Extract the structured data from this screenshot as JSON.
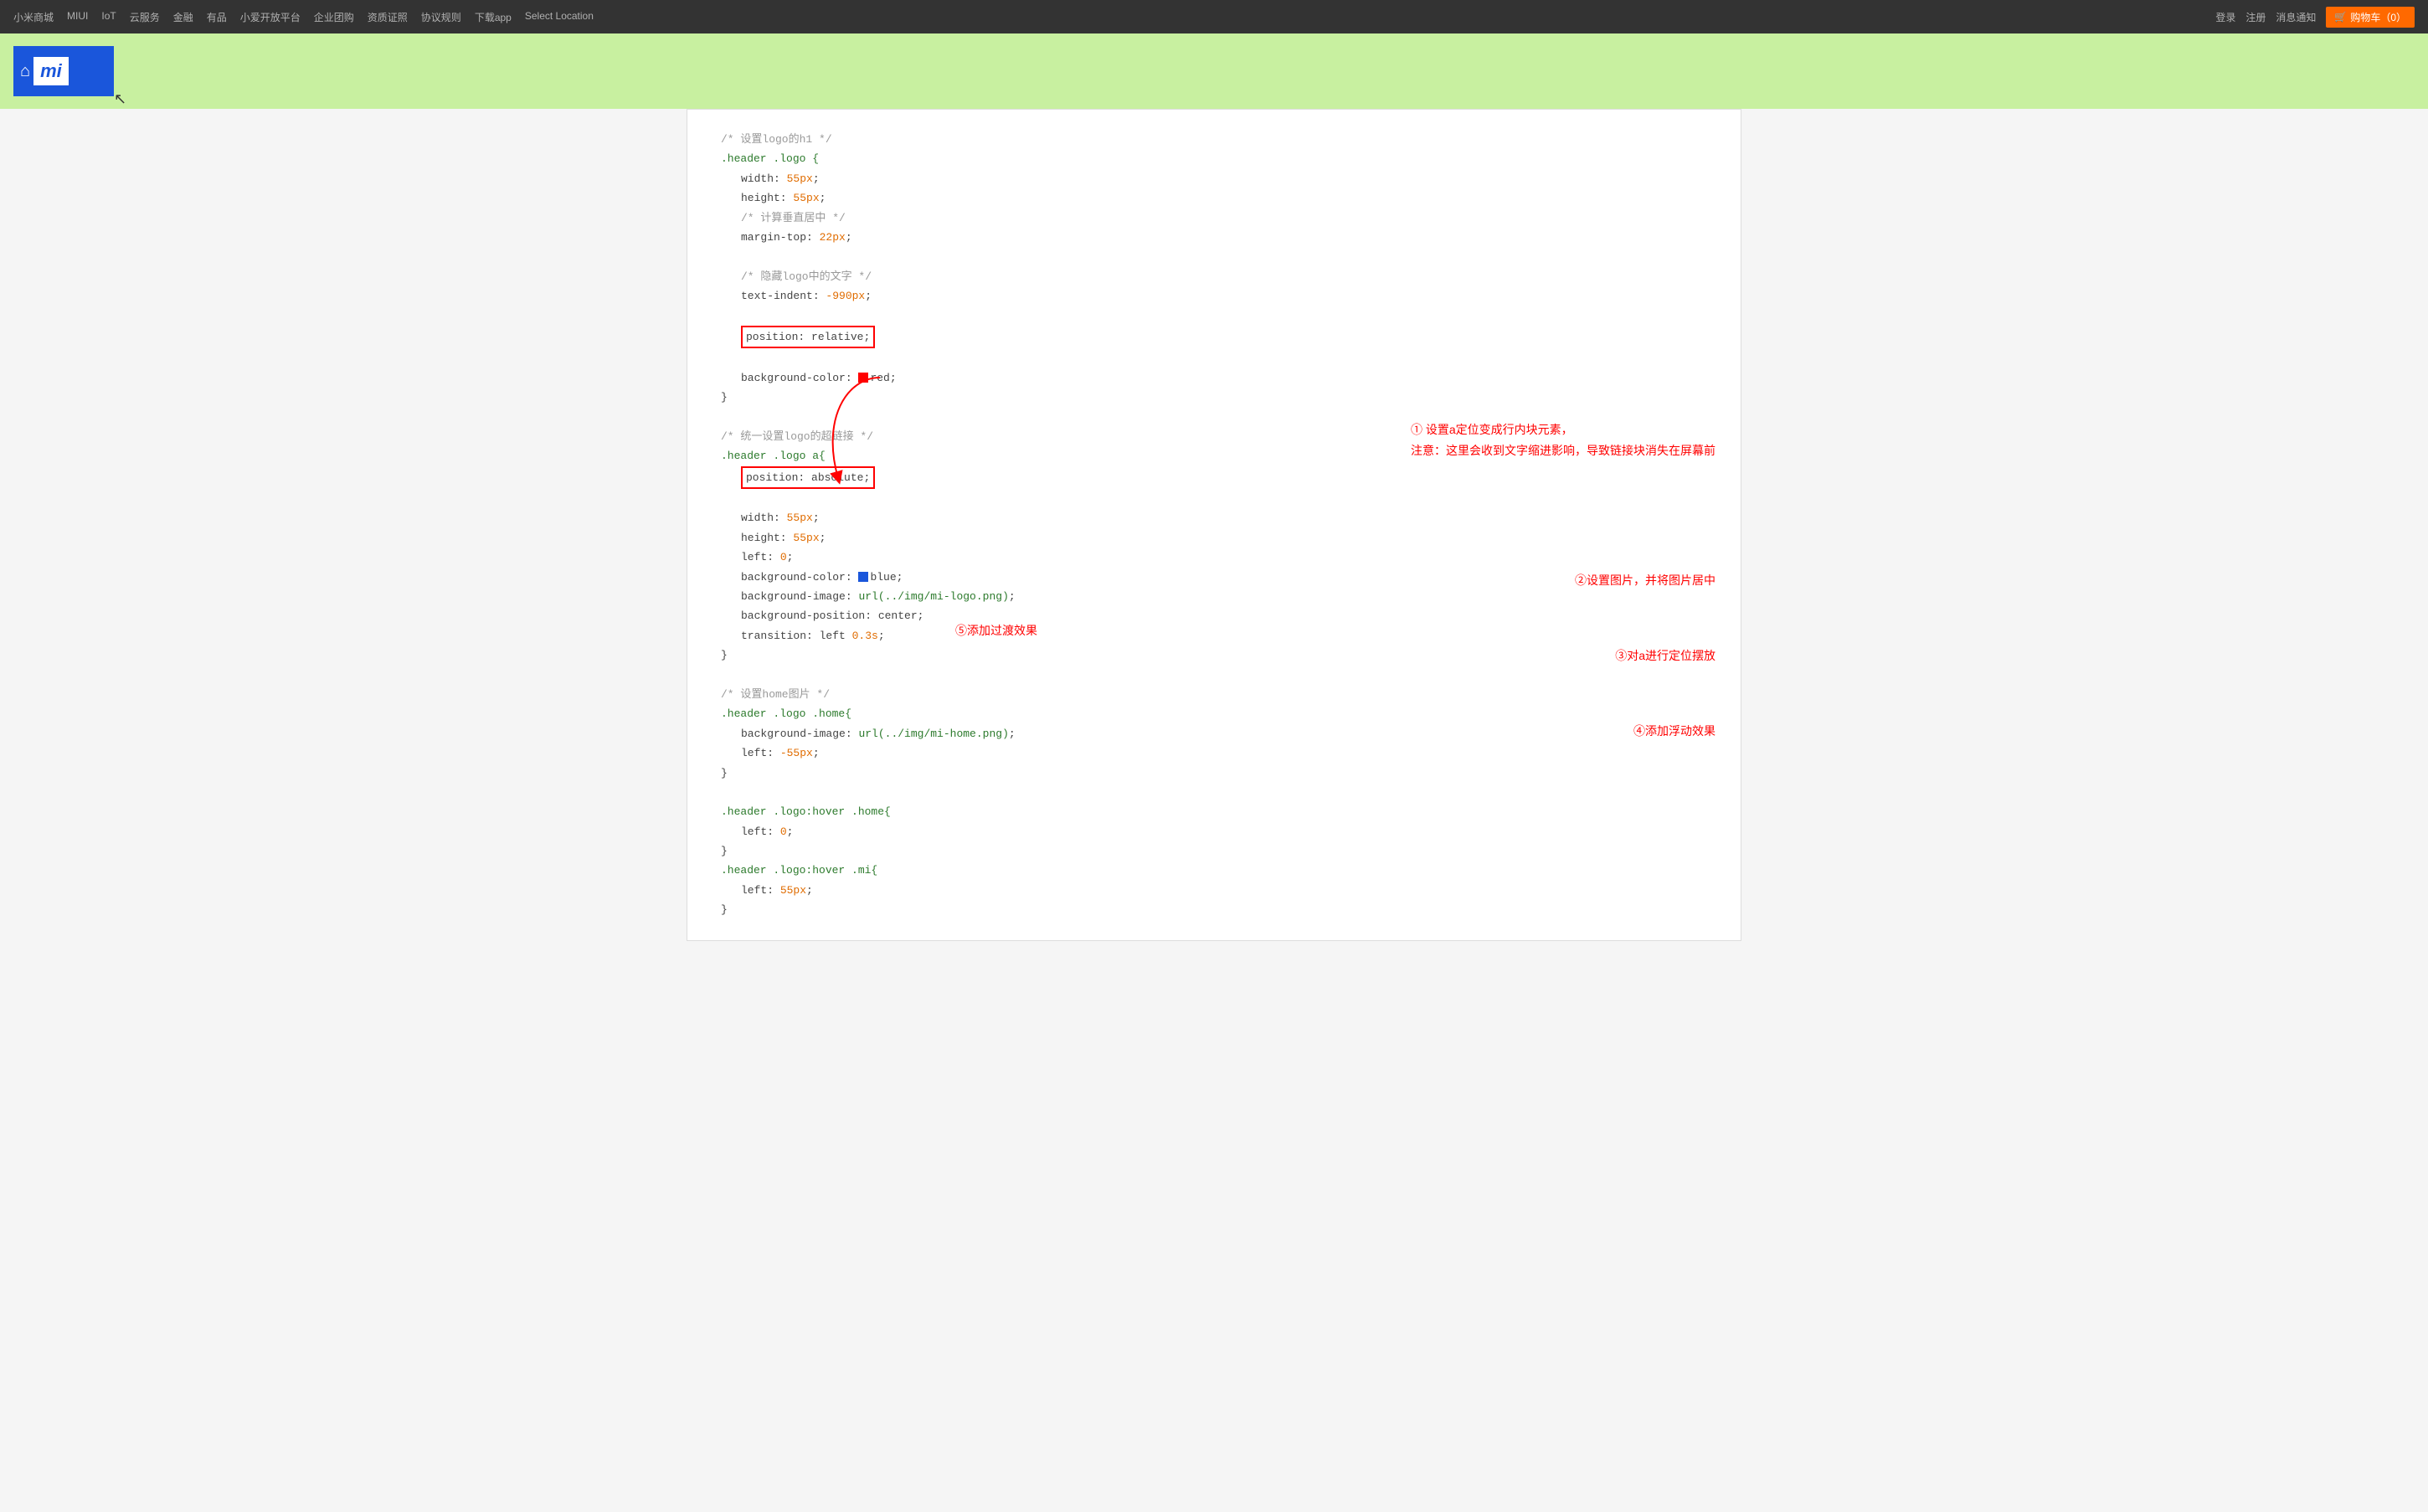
{
  "nav": {
    "left_links": [
      "小米商城",
      "MIUI",
      "IoT",
      "云服务",
      "金融",
      "有品",
      "小爱开放平台",
      "企业团购",
      "资质证照",
      "协议规则",
      "下载app",
      "Select Location"
    ],
    "right_links": [
      "登录",
      "注册",
      "消息通知"
    ],
    "cart_label": "购物车（0）"
  },
  "logo": {
    "home_icon": "⌂",
    "mi_text": "mi"
  },
  "code": {
    "title": "/* 设置logo的h1 */"
  },
  "annotations": {
    "a1_title": "① 设置a定位变成行内块元素，",
    "a1_note": "注意：这里会收到文字缩进影响，导致链接块消失在屏幕前",
    "a2": "②设置图片，并将图片居中",
    "a3": "③对a进行定位摆放",
    "a4": "④添加浮动效果",
    "a5": "⑤添加过渡效果"
  }
}
